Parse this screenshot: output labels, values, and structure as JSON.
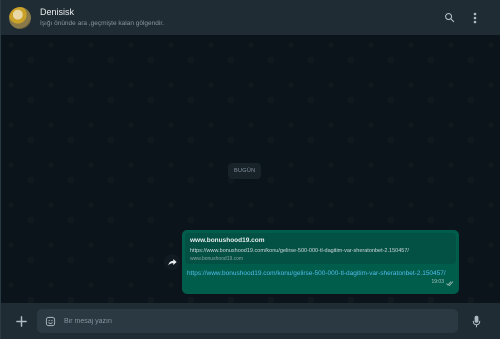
{
  "header": {
    "contact_name": "Denisisk",
    "status": "Işığı önünde ara ,geçmişte kalan gölgendir."
  },
  "chat": {
    "date_label": "BUGÜN",
    "message": {
      "preview_title": "www.bonushood19.com",
      "preview_description": "https://www.bonushood19.com/konu/gelirse-500-000-tl-dagitim-var-sheratonbet-2.150457/",
      "preview_domain": "www.bonushood19.com",
      "link_text": "https://www.bonushood19.com/konu/gelirse-500-000-tl-dagitim-var-sheratonbet-2.150457/",
      "time": "19:03",
      "status_icon": "double-check-icon"
    }
  },
  "footer": {
    "input_placeholder": "Bir mesaj yazın",
    "input_value": ""
  },
  "colors": {
    "header_bg": "#202c33",
    "chat_bg": "#0b141a",
    "outgoing_bubble": "#005c4b",
    "link": "#53bdeb",
    "muted_text": "#8696a0"
  },
  "icons": {
    "search": "search-icon",
    "menu": "menu-kebab-icon",
    "forward": "forward-icon",
    "attach": "plus-icon",
    "emoji": "emoji-icon",
    "mic": "mic-icon"
  }
}
